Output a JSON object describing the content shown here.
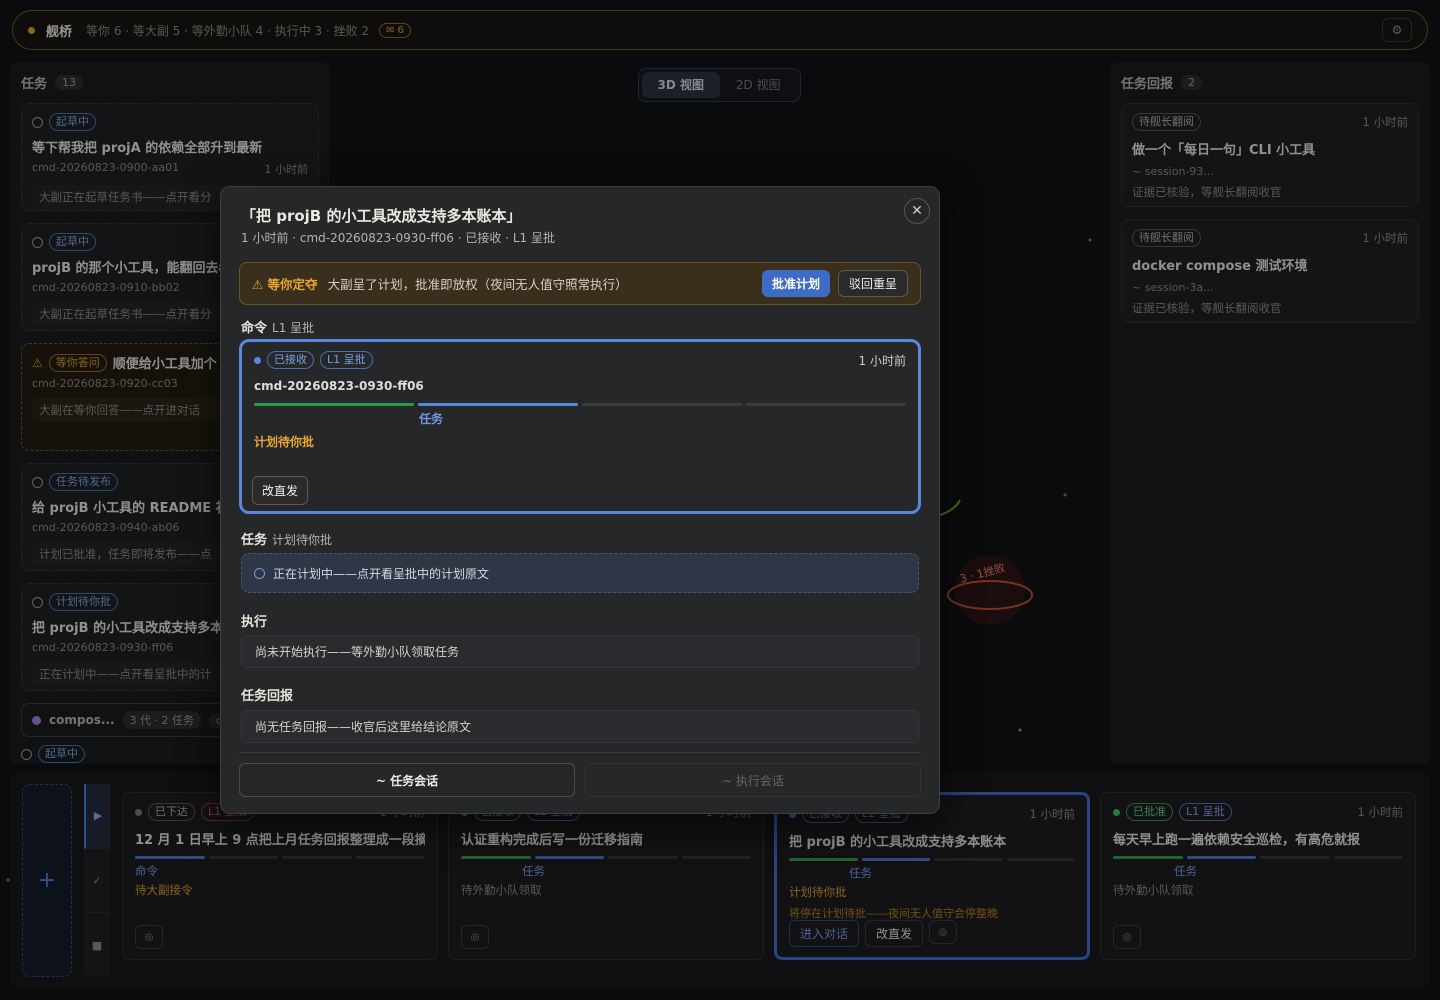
{
  "topbar": {
    "brand": "舰桥",
    "stats": "等你 6 · 等大副 5 · 等外勤小队 4 · 执行中 3 · 挫败 2",
    "mail_count": "✉ 6",
    "settings_icon": "gear-icon"
  },
  "left_panel": {
    "title": "任务",
    "count": "13",
    "cards": [
      {
        "tag": "起草中",
        "title": "等下帮我把 projA 的依赖全部升到最新",
        "id": "cmd-20260823-0900-aa01",
        "time": "1 小时前",
        "note": "大副正在起草任务书——点开看分"
      },
      {
        "tag": "起草中",
        "title": "projB 的那个小工具，能翻回去看",
        "id": "cmd-20260823-0910-bb02",
        "time": "",
        "note": "大副正在起草任务书——点开看分"
      },
      {
        "tag": "等你答问",
        "title": "顺便给小工具加个",
        "id": "cmd-20260823-0920-cc03",
        "time": "",
        "note": "大副在等你回答——点开进对话"
      },
      {
        "tag": "任务待发布",
        "title": "给 projB 小工具的 README 补一",
        "id": "cmd-20260823-0940-ab06",
        "time": "",
        "note": "计划已批准，任务即将发布——点"
      },
      {
        "tag": "计划待你批",
        "title": "把 projB 的小工具改成支持多本账",
        "id": "cmd-20260823-0930-ff06",
        "time": "",
        "note": "正在计划中——点开看呈批中的计"
      }
    ],
    "group": {
      "name": "compos...",
      "meta": "3 代 · 2 任务",
      "extra": "cc"
    },
    "group_tag": "起草中"
  },
  "view_tabs": {
    "tab_3d": "3D 视图",
    "tab_2d": "2D 视图"
  },
  "right_panel": {
    "title": "任务回报",
    "count": "2",
    "cards": [
      {
        "tag": "待舰长翻阅",
        "time": "1 小时前",
        "title": "做一个「每日一句」CLI 小工具",
        "session": "~ session-93...",
        "note": "证据已核验，等舰长翻阅收官"
      },
      {
        "tag": "待舰长翻阅",
        "time": "1 小时前",
        "title": "docker compose 测试环境",
        "session": "~ session-3a...",
        "note": "证据已核验，等舰长翻阅收官"
      }
    ]
  },
  "scene": {
    "planet_label": "3 · 1挫败"
  },
  "bottom": {
    "add_icon": "plus-icon",
    "tools": [
      "▶",
      "✓",
      "■"
    ],
    "cards": [
      {
        "status": "已下达",
        "tag": "L1 呈批",
        "time": "1 小时前",
        "title": "12 月 1 日早上 9 点把上月任务回报整理成一段摘...",
        "stage": "命令",
        "state": "待大副接令",
        "warn": "",
        "btn1": "",
        "btn2": ""
      },
      {
        "status": "已接收",
        "tag": "L1 呈批",
        "time": "1 小时前",
        "title": "认证重构完成后写一份迁移指南",
        "stage": "任务",
        "state": "待外勤小队领取",
        "warn": "",
        "btn1": "",
        "btn2": ""
      },
      {
        "status": "已接收",
        "tag": "L1 呈批",
        "time": "1 小时前",
        "title": "把 projB 的小工具改成支持多本账本",
        "stage": "任务",
        "state": "计划待你批",
        "warn": "将停在计划待批——夜间无人值守会停整晚",
        "btn1": "进入对话",
        "btn2": "改直发"
      },
      {
        "status": "已批准",
        "tag": "L1 呈批",
        "time": "1 小时前",
        "title": "每天早上跑一遍依赖安全巡检，有高危就报",
        "stage": "任务",
        "state": "待外勤小队领取",
        "warn": "",
        "btn1": "",
        "btn2": ""
      }
    ]
  },
  "modal": {
    "title": "「把 projB 的小工具改成支持多本账本」",
    "subtitle": "1 小时前 · cmd-20260823-0930-ff06 · 已接收 · L1 呈批",
    "close_icon": "close-icon",
    "approval": {
      "label": "⚠ 等你定夺",
      "text": "大副呈了计划，批准即放权（夜间无人值守照常执行）",
      "approve": "批准计划",
      "reject": "驳回重呈"
    },
    "command_section": {
      "title": "命令",
      "sub": "L1 呈批"
    },
    "command": {
      "tag1": "已接收",
      "tag2": "L1 呈批",
      "time": "1 小时前",
      "id": "cmd-20260823-0930-ff06",
      "stage": "任务",
      "status": "计划待你批",
      "resend": "改直发"
    },
    "task_section": {
      "title": "任务",
      "sub": "计划待你批"
    },
    "task_text": "正在计划中——点开看呈批中的计划原文",
    "exec_section": {
      "title": "执行"
    },
    "exec_text": "尚未开始执行——等外勤小队领取任务",
    "report_section": {
      "title": "任务回报"
    },
    "report_text": "尚无任务回报——收官后这里给结论原文",
    "btn_task_chat": "~ 任务会话",
    "btn_exec_chat": "~ 执行会话"
  }
}
